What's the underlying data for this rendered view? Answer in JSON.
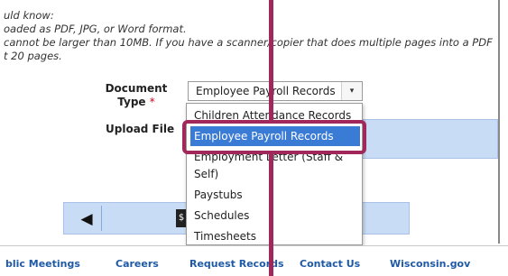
{
  "info_lines": [
    "uld know:",
    "oaded as PDF, JPG, or Word format.",
    "cannot be larger than 10MB. If you have a scanner/copier that does multiple pages into a PDF",
    "t 20 pages."
  ],
  "form": {
    "document_type_label_line1": "Document",
    "document_type_label_line2": "Type",
    "required_mark": "*",
    "document_type_value": "Employee Payroll Records",
    "select_arrow": "▾",
    "upload_file_label": "Upload File"
  },
  "dropdown": {
    "options": [
      "Children Attendance Records",
      "Employee Payroll Records",
      "Employment Letter (Staff &",
      "Self)",
      "Paystubs",
      "Schedules",
      "Timesheets"
    ],
    "selected": "Employee Payroll Records"
  },
  "nav": {
    "prev_symbol": "◀",
    "dollar_symbol": "$"
  },
  "footer": {
    "links": [
      "blic Meetings",
      "Careers",
      "Request Records",
      "Contact Us",
      "Wisconsin.gov"
    ]
  },
  "colors": {
    "callout": "#a1285a",
    "highlight": "#3a7bd5",
    "link": "#1f5aa6",
    "panel": "#c9dcf5"
  },
  "icons": {
    "prev": "left-triangle-icon",
    "dollar": "dollar-icon",
    "select": "chevron-down-icon"
  }
}
